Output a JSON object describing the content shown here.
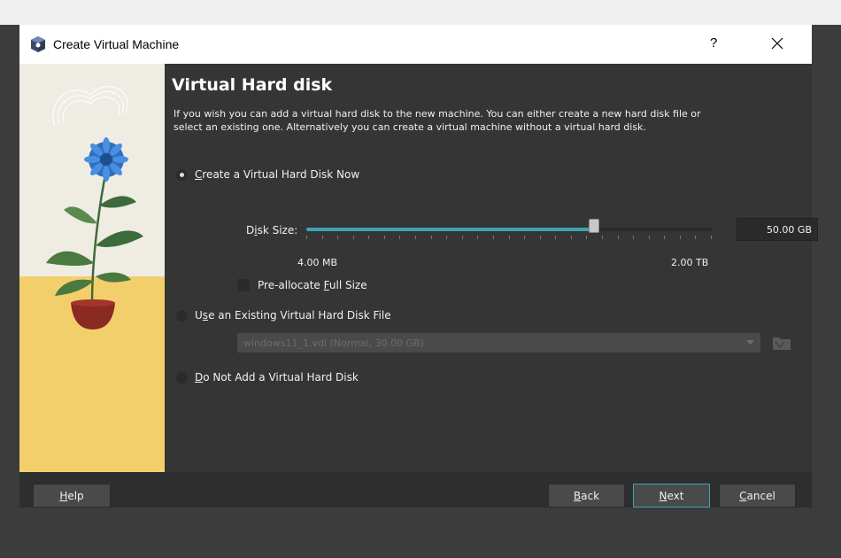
{
  "window": {
    "title": "Create Virtual Machine",
    "help_glyph": "?",
    "close_glyph": "×"
  },
  "page": {
    "heading": "Virtual Hard disk",
    "description": "If you wish you can add a virtual hard disk to the new machine. You can either create a new hard disk file or select an existing one. Alternatively you can create a virtual machine without a virtual hard disk."
  },
  "options": {
    "create_now": {
      "label_pre": "",
      "label_key": "C",
      "label_post": "reate a Virtual Hard Disk Now",
      "selected": true
    },
    "use_existing": {
      "label_pre": "U",
      "label_key": "s",
      "label_post": "e an Existing Virtual Hard Disk File",
      "selected": false
    },
    "do_not_add": {
      "label_pre": "",
      "label_key": "D",
      "label_post": "o Not Add a Virtual Hard Disk",
      "selected": false
    }
  },
  "disk_size": {
    "label_pre": "D",
    "label_key": "i",
    "label_post": "sk Size:",
    "value": "50.00 GB",
    "min_label": "4.00 MB",
    "max_label": "2.00 TB",
    "slider_fraction": 0.71
  },
  "preallocate": {
    "label_pre": "Pre-allocate ",
    "label_key": "F",
    "label_post": "ull Size",
    "checked": false
  },
  "existing_file": {
    "selected": "windows11_1.vdi (Normal, 30.00 GB)"
  },
  "buttons": {
    "help": {
      "key": "H",
      "rest": "elp"
    },
    "back": {
      "key": "B",
      "rest": "ack"
    },
    "next": {
      "key": "N",
      "rest": "ext"
    },
    "cancel": {
      "pre": "",
      "key": "C",
      "rest": "ancel"
    }
  },
  "colors": {
    "accent": "#3ba3b4",
    "dialog_bg": "#353535",
    "footer_bg": "#2e2e2e"
  }
}
